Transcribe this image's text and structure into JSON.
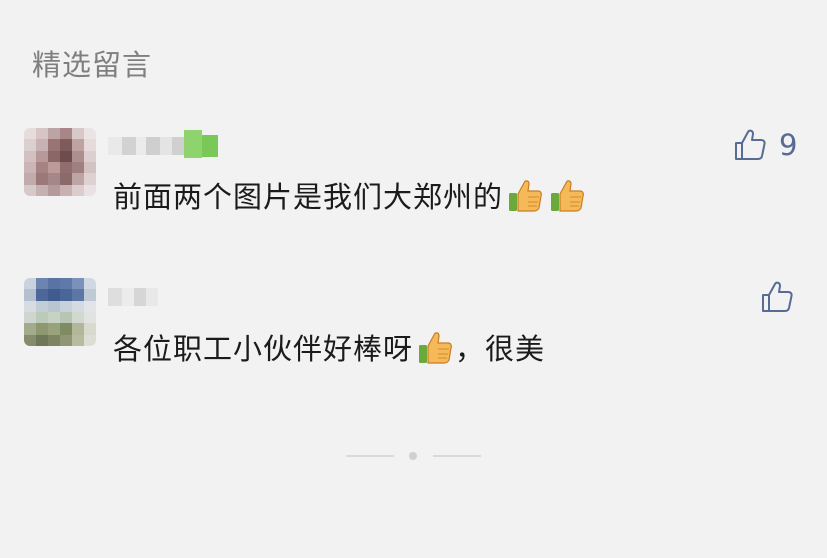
{
  "section": {
    "title": "精选留言"
  },
  "comments": [
    {
      "text": "前面两个图片是我们大郑州的",
      "emoji_icons": [
        "thumbs-up-emoji",
        "thumbs-up-emoji"
      ],
      "likes": "9"
    },
    {
      "text_before": "各位职工小伙伴好棒呀",
      "emoji_icons": [
        "thumbs-up-emoji"
      ],
      "text_after": "，很美",
      "likes": ""
    }
  ],
  "colors": {
    "background": "#f2f2f2",
    "accent": "#576b95",
    "title": "#7f7f7f",
    "text": "#1b1b1b"
  },
  "icons": {
    "like": "thumbs-up-outline-icon",
    "emoji": "thumbs-up-emoji"
  }
}
